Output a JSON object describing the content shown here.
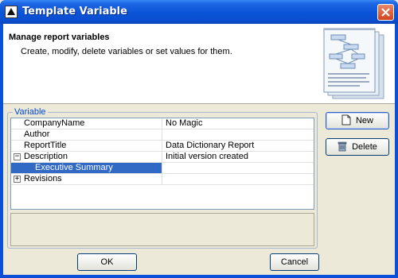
{
  "window": {
    "title": "Template Variable"
  },
  "header": {
    "title": "Manage report variables",
    "description": "Create, modify, delete variables or set values for them."
  },
  "group": {
    "label": "Variable"
  },
  "variables": [
    {
      "name": "CompanyName",
      "value": "No Magic",
      "expander": ""
    },
    {
      "name": "Author",
      "value": "",
      "expander": ""
    },
    {
      "name": "ReportTitle",
      "value": "Data Dictionary Report",
      "expander": ""
    },
    {
      "name": "Description",
      "value": "Initial version created",
      "expander": "−"
    },
    {
      "name": "Executive Summary",
      "value": "",
      "expander": ""
    },
    {
      "name": "Revisions",
      "value": "",
      "expander": "+"
    }
  ],
  "buttons": {
    "new": "New",
    "delete": "Delete",
    "ok": "OK",
    "cancel": "Cancel"
  },
  "colors": {
    "selection": "#316ac5",
    "titlebar": "#0b55d8",
    "group_label": "#0046d5"
  }
}
